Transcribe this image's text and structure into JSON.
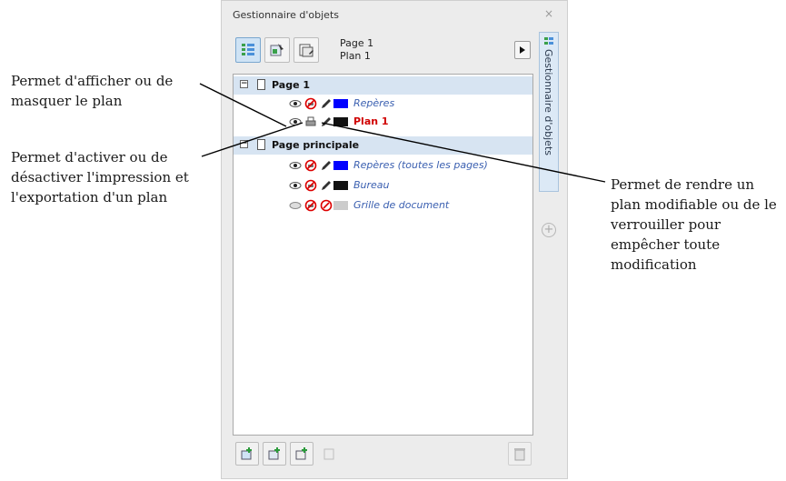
{
  "callouts": {
    "visibility": "Permet d'afficher ou de masquer le plan",
    "printing": "Permet d'activer ou de désactiver l'impression et l'exportation d'un plan",
    "lock": "Permet de rendre un plan modifiable ou de le verrouiller pour empêcher toute modification"
  },
  "docker": {
    "title": "Gestionnaire d'objets",
    "close": "×",
    "vertical_tab": "Gestionnaire d'objets",
    "current_page": "Page 1",
    "current_layer": "Plan 1",
    "add_symbol": "+",
    "toolbar_icons": [
      "layer-manager-view-icon",
      "show-object-properties-icon",
      "edit-across-layers-icon"
    ],
    "bottom_icons": [
      "new-layer-icon",
      "new-master-layer-all-pages-icon",
      "new-master-layer-icon",
      "delete-layer-icon"
    ]
  },
  "tree": {
    "page1": {
      "expander": "−",
      "label": "Page 1",
      "layers": [
        {
          "label": "Repères",
          "color": "#0000ff",
          "current": false
        },
        {
          "label": "Plan 1",
          "color": "#000000",
          "current": true
        }
      ]
    },
    "master": {
      "expander": "−",
      "label": "Page principale",
      "layers": [
        {
          "label": "Repères (toutes les pages)",
          "color": "#0000ff"
        },
        {
          "label": "Bureau",
          "color": "#000000"
        },
        {
          "label": "Grille de document",
          "color": "#cccccc"
        }
      ]
    }
  },
  "colors": {
    "page_row_bg": "#d7e4f2",
    "current_layer": "#d00000",
    "layer_text": "#3a5fb0"
  }
}
